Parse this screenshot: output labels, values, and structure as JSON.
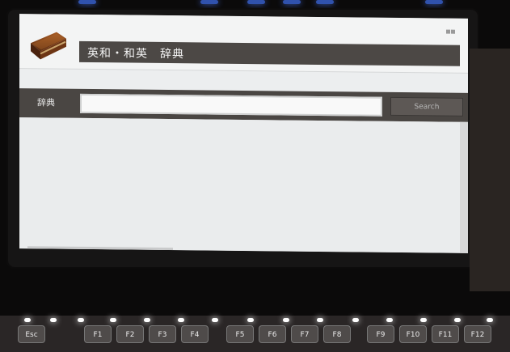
{
  "app": {
    "title": "英和・和英　辞典"
  },
  "search": {
    "label": "辞典",
    "input_value": "",
    "placeholder": "",
    "button_label": "Search"
  },
  "keyboard": {
    "keys": [
      "Esc",
      "F1",
      "F2",
      "F3",
      "F4",
      "F5",
      "F6",
      "F7",
      "F8",
      "F9",
      "F10",
      "F11",
      "F12"
    ]
  },
  "icons": {
    "book": "book-icon"
  },
  "colors": {
    "title_bar": "#4c4845",
    "search_bar": "#4a4643",
    "screen_bg": "#eceeef"
  }
}
